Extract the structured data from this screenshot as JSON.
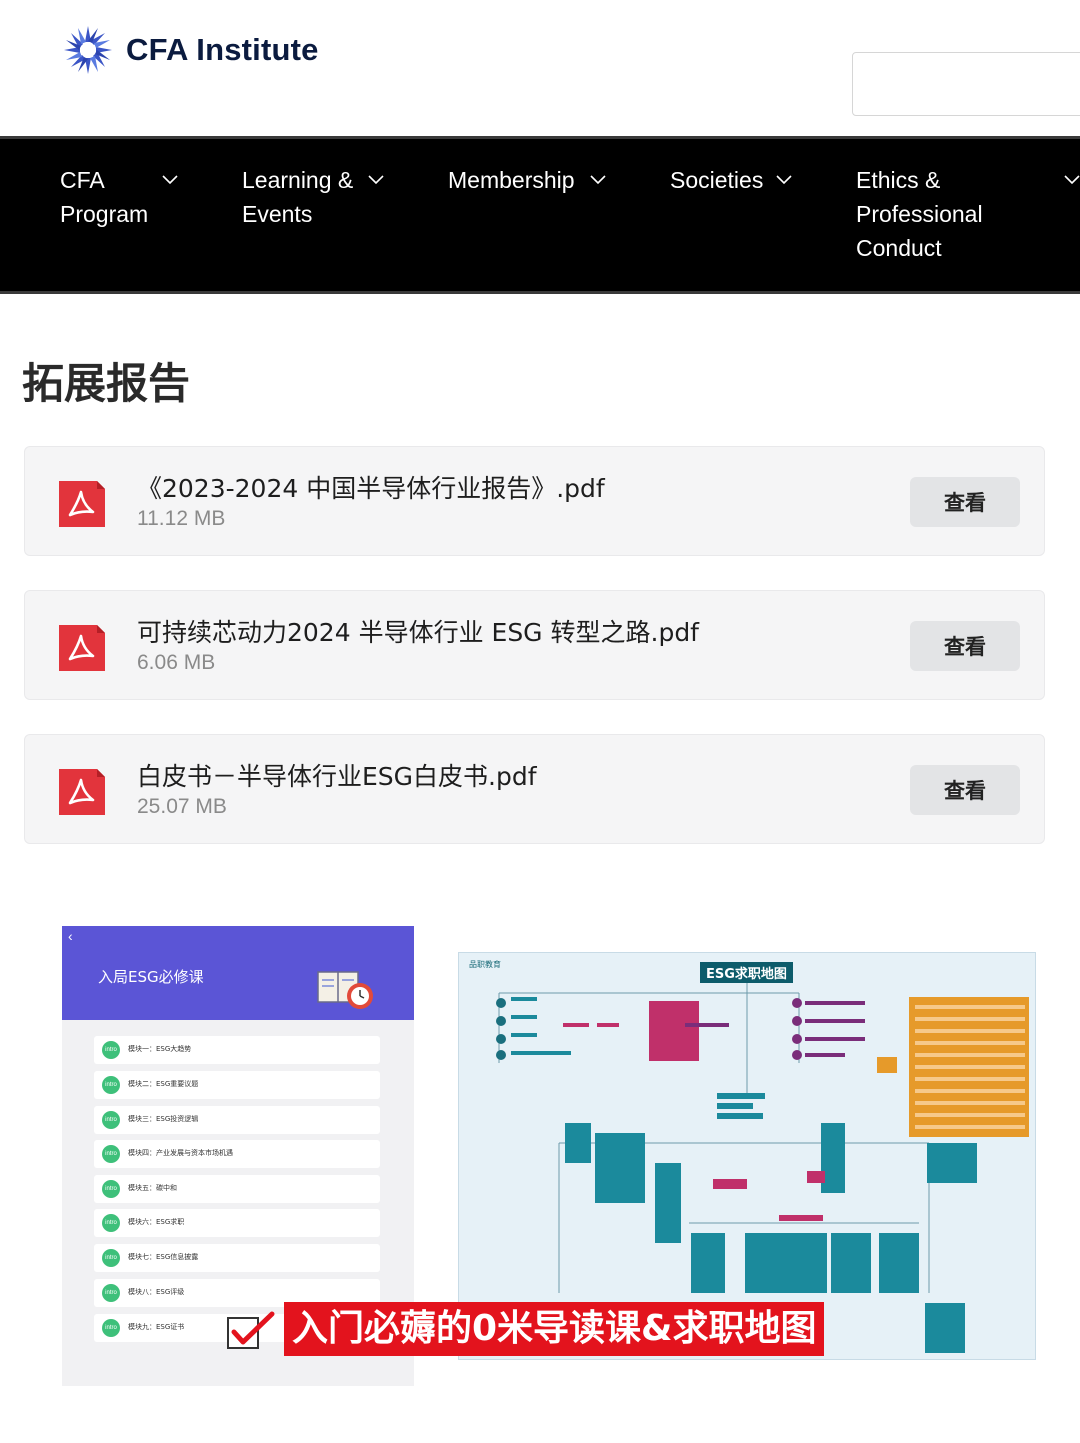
{
  "header": {
    "logo_text": "CFA Institute"
  },
  "nav": {
    "items": [
      {
        "label": "CFA\nProgram"
      },
      {
        "label": "Learning &\nEvents"
      },
      {
        "label": "Membership"
      },
      {
        "label": "Societies"
      },
      {
        "label": "Ethics &\nProfessional\nConduct"
      }
    ]
  },
  "section": {
    "title": "拓展报告"
  },
  "files": [
    {
      "name": "《2023-2024 中国半导体行业报告》.pdf",
      "size": "11.12 MB",
      "action": "查看"
    },
    {
      "name": "可持续芯动力2024 半导体行业 ESG 转型之路.pdf",
      "size": "6.06 MB",
      "action": "查看"
    },
    {
      "name": "白皮书－半导体行业ESG白皮书.pdf",
      "size": "25.07 MB",
      "action": "查看"
    }
  ],
  "course": {
    "back": "‹",
    "title": "入局ESG必修课",
    "badge": "intro",
    "modules": [
      "模块一：ESG大趋势",
      "模块二：ESG重要议题",
      "模块三：ESG投资逻辑",
      "模块四：产业发展与资本市场机遇",
      "模块五：碳中和",
      "模块六：ESG求职",
      "模块七：ESG信息披露",
      "模块八：ESG评级",
      "模块九：ESG证书"
    ]
  },
  "map": {
    "brand": "品职教育",
    "title": "ESG求职地图"
  },
  "caption": {
    "text": "入门必薅的0米导读课&求职地图"
  },
  "colors": {
    "nav_bg": "#000000",
    "course_header": "#5b55d6",
    "caption_bg": "#e3131d",
    "pdf_red": "#e2343c",
    "map_teal": "#0d5c6b"
  }
}
